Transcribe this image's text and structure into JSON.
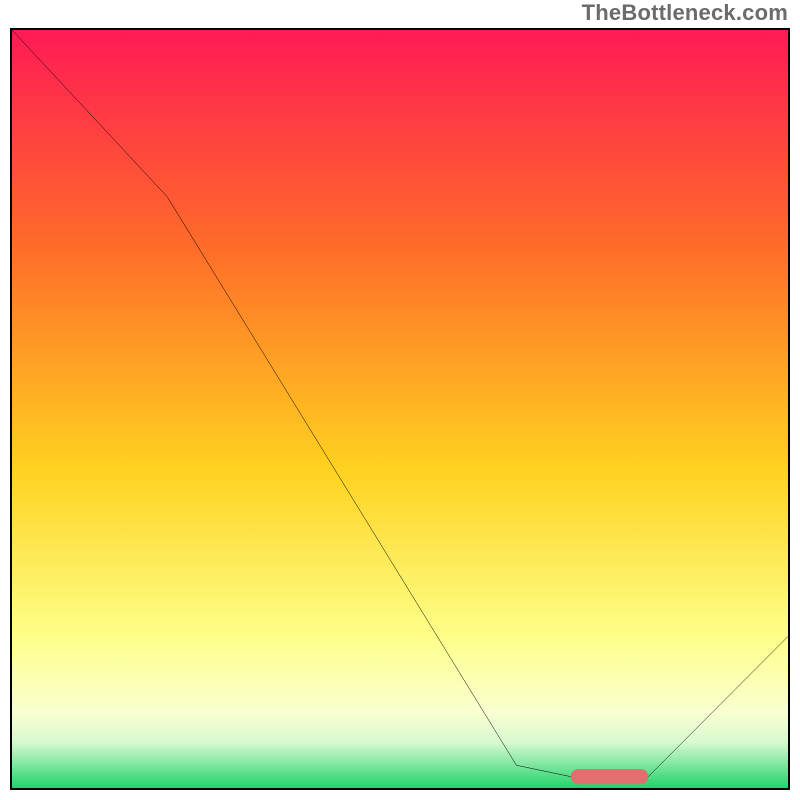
{
  "watermark": "TheBottleneck.com",
  "colors": {
    "top": "#ff1a55",
    "mid1": "#ff6a2a",
    "mid2": "#ffd21f",
    "pale": "#feff89",
    "cream": "#f9ffd0",
    "mint": "#d7f9d0",
    "green": "#22d36b",
    "line": "#000000",
    "marker": "#e07070",
    "border": "#000000"
  },
  "chart_data": {
    "type": "line",
    "title": "",
    "xlabel": "",
    "ylabel": "",
    "xlim": [
      0,
      100
    ],
    "ylim": [
      0,
      100
    ],
    "grid": false,
    "legend": false,
    "series": [
      {
        "name": "bottleneck-curve",
        "x": [
          0,
          20,
          65,
          72,
          82,
          100
        ],
        "values": [
          100,
          78,
          3,
          1.5,
          1.5,
          20
        ]
      }
    ],
    "annotations": [
      {
        "name": "optimal-range-bar",
        "x0": 72,
        "x1": 82,
        "y": 1.5
      }
    ],
    "background_gradient_stops": [
      {
        "pct": 0,
        "color": "#ff1a55"
      },
      {
        "pct": 28,
        "color": "#ff6a2a"
      },
      {
        "pct": 58,
        "color": "#ffd21f"
      },
      {
        "pct": 80,
        "color": "#feff89"
      },
      {
        "pct": 90,
        "color": "#f9ffd0"
      },
      {
        "pct": 94,
        "color": "#d7f9d0"
      },
      {
        "pct": 100,
        "color": "#22d36b"
      }
    ]
  }
}
